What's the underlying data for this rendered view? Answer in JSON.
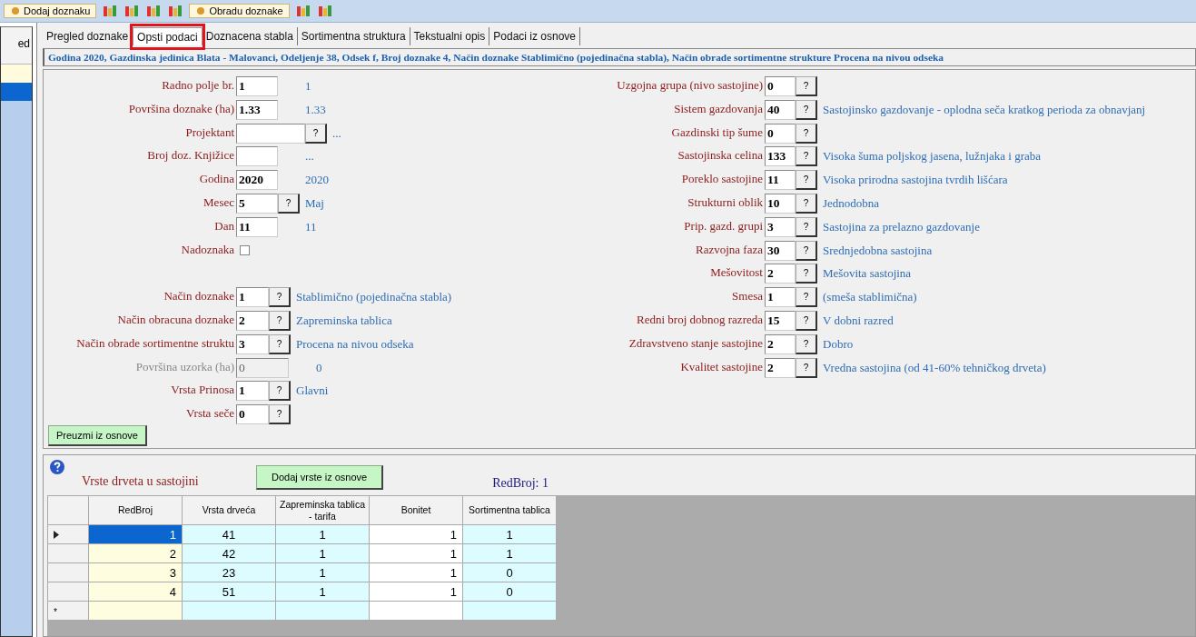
{
  "toolbar": [
    {
      "kind": "button",
      "label": "Dodaj doznaku"
    },
    {
      "kind": "icon"
    },
    {
      "kind": "icon"
    },
    {
      "kind": "icon"
    },
    {
      "kind": "icon"
    },
    {
      "kind": "button",
      "label": "Obradu doznake"
    },
    {
      "kind": "icon"
    },
    {
      "kind": "icon"
    }
  ],
  "side_panel": {
    "header": "ed",
    "items": [
      {
        "selected": false
      },
      {
        "selected": true
      }
    ]
  },
  "tabs": [
    {
      "label": "Pregled doznake",
      "selected": false
    },
    {
      "label": "Opsti podaci",
      "selected": true,
      "highlighted": true
    },
    {
      "label": "Doznacena stabla",
      "selected": false
    },
    {
      "label": "Sortimentna struktura",
      "selected": false
    },
    {
      "label": "Tekstualni opis",
      "selected": false
    },
    {
      "label": "Podaci iz osnove",
      "selected": false
    }
  ],
  "info_bar": "Godina 2020, Gazdinska jedinica Blata - Malovanci, Odeljenje 38, Odsek f, Broj doznake 4, Način doznake Stablimično (pojedinačna stabla), Način obrade sortimentne strukture Procena na nivou odseka",
  "left_fields": [
    {
      "kind": "input",
      "label": "Radno polje br.",
      "value": "1",
      "lookup": false,
      "description": "1"
    },
    {
      "kind": "input",
      "label": "Površina doznake (ha)",
      "value": "1.33",
      "lookup": false,
      "description": "1.33"
    },
    {
      "kind": "wide",
      "label": "Projektant",
      "lookup": true,
      "description": "..."
    },
    {
      "kind": "input",
      "label": "Broj doz. Knjižice",
      "lookup": false,
      "description": "..."
    },
    {
      "kind": "input",
      "label": "Godina",
      "value": "2020",
      "lookup": false,
      "description": "2020"
    },
    {
      "kind": "input",
      "label": "Mesec",
      "value": "5",
      "lookup": true,
      "description": "Maj"
    },
    {
      "kind": "input",
      "label": "Dan",
      "value": "11",
      "lookup": false,
      "description": "11"
    },
    {
      "kind": "checkbox",
      "label": "Nadoznaka",
      "checked": false
    },
    {
      "kind": "spacer"
    },
    {
      "kind": "short",
      "label": "Način doznake",
      "value": "1",
      "lookup": true,
      "description": "Stablimično (pojedinačna stabla)"
    },
    {
      "kind": "short",
      "label": "Način obracuna doznake",
      "value": "2",
      "lookup": true,
      "description": "Zapreminska tablica"
    },
    {
      "kind": "short",
      "label": "Način obrade sortimentne struktu",
      "value": "3",
      "lookup": true,
      "description": "Procena na nivou odseka"
    },
    {
      "kind": "disabled",
      "label": "Površina uzorka (ha)",
      "value": "0",
      "lookup": false,
      "description": "0"
    },
    {
      "kind": "short",
      "label": "Vrsta Prinosa",
      "value": "1",
      "lookup": true,
      "description": "Glavni"
    },
    {
      "kind": "short",
      "label": "Vrsta seče",
      "value": "0",
      "lookup": true
    }
  ],
  "right_fields": [
    {
      "label": "Uzgojna grupa (nivo sastojine)",
      "value": "0"
    },
    {
      "label": "Sistem gazdovanja",
      "value": "40",
      "description": "Sastojinsko gazdovanje - oplodna seča kratkog perioda za obnavjanj"
    },
    {
      "label": "Gazdinski tip šume",
      "value": "0"
    },
    {
      "label": "Sastojinska celina",
      "value": "133",
      "description": "Visoka šuma poljskog jasena, lužnjaka i graba"
    },
    {
      "label": "Poreklo sastojine",
      "value": "11",
      "description": "Visoka prirodna sastojina tvrdih lišćara"
    },
    {
      "label": "Strukturni oblik",
      "value": "10",
      "description": "Jednodobna"
    },
    {
      "label": "Prip. gazd. grupi",
      "value": "3",
      "description": "Sastojina za prelazno gazdovanje"
    },
    {
      "label": "Razvojna faza",
      "value": "30",
      "description": "Srednjedobna sastojina"
    },
    {
      "label": "Mešovitost",
      "value": "2",
      "description": "Mešovita sastojina"
    },
    {
      "label": "Smesa",
      "value": "1",
      "description": "(smeša stablimična)"
    },
    {
      "label": "Redni broj dobnog razreda",
      "value": "15",
      "description": "V dobni razred"
    },
    {
      "label": "Zdravstveno stanje sastojine",
      "value": "2",
      "description": "Dobro"
    },
    {
      "label": "Kvalitet sastojine",
      "value": "2",
      "description": "Vredna sastojina (od 41-60% tehničkog drveta)"
    }
  ],
  "lookup_button": "?",
  "preuzmi_button": "Preuzmi iz osnove",
  "species": {
    "title": "Vrste drveta u sastojini",
    "add_button": "Dodaj vrste iz osnove",
    "red_broj": "RedBroj: 1",
    "columns": [
      {
        "label": "RedBroj",
        "color": "#fffde0"
      },
      {
        "label": "Vrsta drveća",
        "color": "#dcfcff"
      },
      {
        "label": "Zapreminska tablica - tarifa",
        "color": "#dcfcff"
      },
      {
        "label": "Bonitet",
        "color": "#ffffff"
      },
      {
        "label": "Sortimentna tablica",
        "color": "#dcfcff"
      }
    ],
    "rows": [
      {
        "selected": true,
        "cells": [
          "1",
          "41",
          "1",
          "1",
          "1"
        ]
      },
      {
        "selected": false,
        "cells": [
          "2",
          "42",
          "1",
          "1",
          "1"
        ]
      },
      {
        "selected": false,
        "cells": [
          "3",
          "23",
          "1",
          "1",
          "0"
        ]
      },
      {
        "selected": false,
        "cells": [
          "4",
          "51",
          "1",
          "1",
          "0"
        ]
      }
    ],
    "new_row_marker": "*"
  }
}
